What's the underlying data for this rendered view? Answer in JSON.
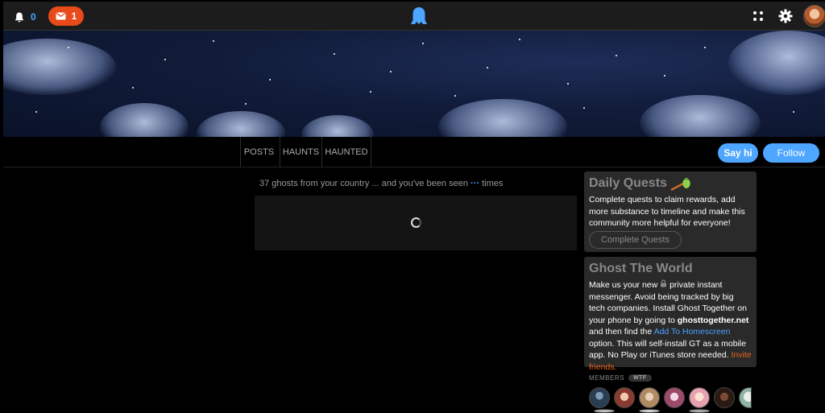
{
  "topbar": {
    "notifications_count": "0",
    "messages_count": "1",
    "icons": [
      "bell-icon",
      "envelope-icon",
      "ghost-logo-icon",
      "apps-grid-icon",
      "gear-icon",
      "user-avatar"
    ]
  },
  "tabs": [
    "POSTS",
    "HAUNTS",
    "HAUNTED"
  ],
  "actions": {
    "say_hi": "Say hi",
    "follow": "Follow"
  },
  "feed": {
    "country_prefix": "37 ghosts from your country",
    "ellipsis": "...",
    "country_middle": "and you've been seen",
    "seen_dots": "···",
    "country_suffix": "times"
  },
  "quests": {
    "title": "Daily Quests",
    "text": "Complete quests to claim rewards, add more substance to timeline and make this community more helpful for everyone!",
    "button": "Complete Quests"
  },
  "world": {
    "title": "Ghost The World",
    "text_1": "Make us your new",
    "text_2": "private instant messenger. Avoid being tracked by big tech companies. Install Ghost Together on your phone by going to",
    "domain": "ghosttogether.net",
    "text_3": "and then find the",
    "homescreen_link": "Add To Homescreen",
    "text_4": "option. This will self-install GT as a mobile app. No Play or iTunes store needed.",
    "invite_link": "Invite friends."
  },
  "members": {
    "label": "MEMBERS",
    "badge": "WTF"
  },
  "colors": {
    "accent_blue": "#4da6ff",
    "accent_orange": "#e84a1a",
    "card_bg": "#2a2a2a"
  }
}
